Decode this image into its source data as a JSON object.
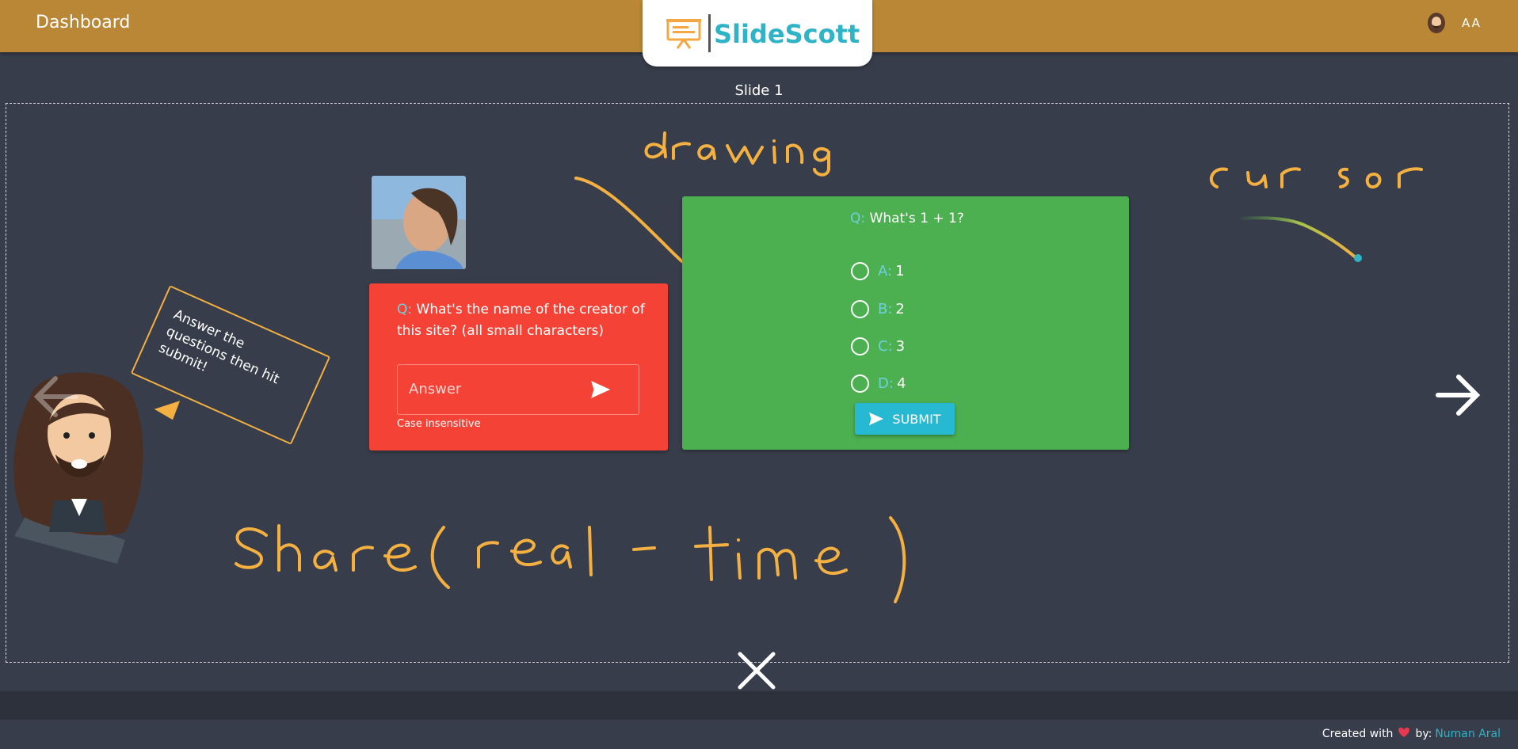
{
  "header": {
    "dashboard_label": "Dashboard",
    "logo_text": "SlideScott",
    "user_initials": "AA"
  },
  "slide": {
    "title": "Slide 1"
  },
  "annotations": {
    "drawing": "drawing",
    "cursor": "cursor",
    "share": "Share(real - time)"
  },
  "text_question": {
    "prefix": "Q:",
    "text": "What's the name of the creator of this site? (all small characters)",
    "placeholder": "Answer",
    "note": "Case insensitive"
  },
  "mc_question": {
    "prefix": "Q:",
    "text": "What's 1 + 1?",
    "options": [
      {
        "letter": "A:",
        "value": "1"
      },
      {
        "letter": "B:",
        "value": "2"
      },
      {
        "letter": "C:",
        "value": "3"
      },
      {
        "letter": "D:",
        "value": "4"
      }
    ],
    "submit_label": "SUBMIT"
  },
  "speech_bubble": {
    "text": "Answer the questions then hit submit!"
  },
  "footer": {
    "created_with": "Created with",
    "by": "by:",
    "author": "Numan Aral"
  },
  "colors": {
    "topbar": "#b98736",
    "background": "#373d4a",
    "red_card": "#f44336",
    "green_card": "#4caf50",
    "accent": "#2fb3c6",
    "ink": "#f4b041"
  }
}
